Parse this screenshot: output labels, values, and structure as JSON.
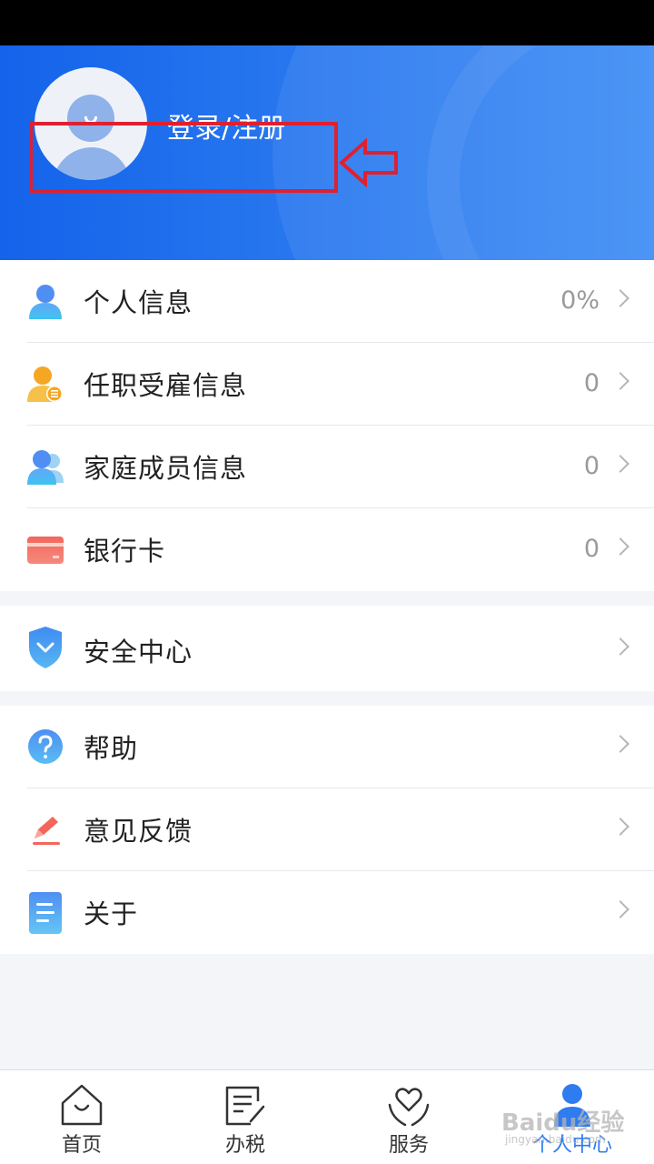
{
  "header": {
    "login_label": "登录/注册"
  },
  "profile_group": [
    {
      "label": "个人信息",
      "value": "0%",
      "icon": "person-icon"
    },
    {
      "label": "任职受雇信息",
      "value": "0",
      "icon": "employment-icon"
    },
    {
      "label": "家庭成员信息",
      "value": "0",
      "icon": "family-icon"
    },
    {
      "label": "银行卡",
      "value": "0",
      "icon": "bank-card-icon"
    }
  ],
  "security_group": [
    {
      "label": "安全中心",
      "icon": "shield-icon"
    }
  ],
  "misc_group": [
    {
      "label": "帮助",
      "icon": "help-icon"
    },
    {
      "label": "意见反馈",
      "icon": "feedback-pen-icon"
    },
    {
      "label": "关于",
      "icon": "document-icon"
    }
  ],
  "tabbar": [
    {
      "label": "首页",
      "icon": "home-icon",
      "active": false
    },
    {
      "label": "办税",
      "icon": "tax-form-icon",
      "active": false
    },
    {
      "label": "服务",
      "icon": "heart-hands-icon",
      "active": false
    },
    {
      "label": "个人中心",
      "icon": "person-center-icon",
      "active": true
    }
  ],
  "watermark": {
    "text": "Baidu经验",
    "sub": "jingyan.baidu.com"
  },
  "colors": {
    "header_blue": "#1463ea",
    "active_tab": "#2f7bf0",
    "annotation_red": "#e0202f"
  }
}
